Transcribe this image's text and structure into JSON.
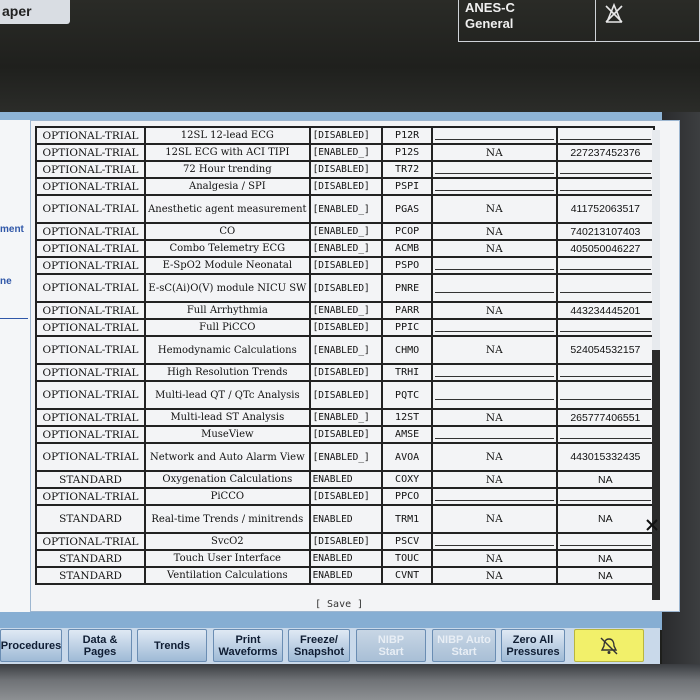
{
  "header": {
    "top_left_fragment": "aper",
    "profile_line1": "ANES-C",
    "profile_line2": "General"
  },
  "left_strip": {
    "fragment1": "ment",
    "fragment2": "ne"
  },
  "licenses": {
    "rows": [
      {
        "type": "OPTIONAL-TRIAL",
        "name": "12SL 12-lead ECG",
        "state": "[DISABLED]",
        "code": "P12R",
        "capability": "",
        "key": ""
      },
      {
        "type": "OPTIONAL-TRIAL",
        "name": "12SL ECG with ACI TIPI",
        "state": "[ENABLED_]",
        "code": "P12S",
        "capability": "NA",
        "key": "227237452376"
      },
      {
        "type": "OPTIONAL-TRIAL",
        "name": "72 Hour trending",
        "state": "[DISABLED]",
        "code": "TR72",
        "capability": "",
        "key": ""
      },
      {
        "type": "OPTIONAL-TRIAL",
        "name": "Analgesia / SPI",
        "state": "[DISABLED]",
        "code": "PSPI",
        "capability": "",
        "key": ""
      },
      {
        "type": "OPTIONAL-TRIAL",
        "name": "Anesthetic agent measurement",
        "state": "[ENABLED_]",
        "code": "PGAS",
        "capability": "NA",
        "key": "411752063517",
        "tall": true
      },
      {
        "type": "OPTIONAL-TRIAL",
        "name": "CO",
        "state": "[ENABLED_]",
        "code": "PCOP",
        "capability": "NA",
        "key": "740213107403"
      },
      {
        "type": "OPTIONAL-TRIAL",
        "name": "Combo Telemetry ECG",
        "state": "[ENABLED_]",
        "code": "ACMB",
        "capability": "NA",
        "key": "405050046227"
      },
      {
        "type": "OPTIONAL-TRIAL",
        "name": "E-SpO2 Module Neonatal",
        "state": "[DISABLED]",
        "code": "PSPO",
        "capability": "",
        "key": ""
      },
      {
        "type": "OPTIONAL-TRIAL",
        "name": "E-sC(Ai)O(V) module NICU SW",
        "state": "[DISABLED]",
        "code": "PNRE",
        "capability": "",
        "key": "",
        "tall": true
      },
      {
        "type": "OPTIONAL-TRIAL",
        "name": "Full Arrhythmia",
        "state": "[ENABLED_]",
        "code": "PARR",
        "capability": "NA",
        "key": "443234445201"
      },
      {
        "type": "OPTIONAL-TRIAL",
        "name": "Full PiCCO",
        "state": "[DISABLED]",
        "code": "PPIC",
        "capability": "",
        "key": ""
      },
      {
        "type": "OPTIONAL-TRIAL",
        "name": "Hemodynamic Calculations",
        "state": "[ENABLED_]",
        "code": "CHMO",
        "capability": "NA",
        "key": "524054532157",
        "tall": true
      },
      {
        "type": "OPTIONAL-TRIAL",
        "name": "High Resolution Trends",
        "state": "[DISABLED]",
        "code": "TRHI",
        "capability": "",
        "key": ""
      },
      {
        "type": "OPTIONAL-TRIAL",
        "name": "Multi-lead QT / QTc Analysis",
        "state": "[DISABLED]",
        "code": "PQTC",
        "capability": "",
        "key": "",
        "tall": true
      },
      {
        "type": "OPTIONAL-TRIAL",
        "name": "Multi-lead ST Analysis",
        "state": "[ENABLED_]",
        "code": "12ST",
        "capability": "NA",
        "key": "265777406551"
      },
      {
        "type": "OPTIONAL-TRIAL",
        "name": "MuseView",
        "state": "[DISABLED]",
        "code": "AMSE",
        "capability": "",
        "key": ""
      },
      {
        "type": "OPTIONAL-TRIAL",
        "name": "Network and Auto Alarm View",
        "state": "[ENABLED_]",
        "code": "AVOA",
        "capability": "NA",
        "key": "443015332435",
        "tall": true
      },
      {
        "type": "STANDARD",
        "name": "Oxygenation Calculations",
        "state": "ENABLED",
        "code": "COXY",
        "capability": "NA",
        "key": "NA"
      },
      {
        "type": "OPTIONAL-TRIAL",
        "name": "PiCCO",
        "state": "[DISABLED]",
        "code": "PPCO",
        "capability": "",
        "key": ""
      },
      {
        "type": "STANDARD",
        "name": "Real-time Trends / minitrends",
        "state": "ENABLED",
        "code": "TRM1",
        "capability": "NA",
        "key": "NA",
        "tall": true
      },
      {
        "type": "OPTIONAL-TRIAL",
        "name": "SvcO2",
        "state": "[DISABLED]",
        "code": "PSCV",
        "capability": "",
        "key": ""
      },
      {
        "type": "STANDARD",
        "name": "Touch User Interface",
        "state": "ENABLED",
        "code": "TOUC",
        "capability": "NA",
        "key": "NA"
      },
      {
        "type": "STANDARD",
        "name": "Ventilation Calculations",
        "state": "ENABLED",
        "code": "CVNT",
        "capability": "NA",
        "key": "NA"
      }
    ]
  },
  "save_label": "[ Save ]",
  "keys": [
    {
      "label": "Procedures",
      "disabled": false
    },
    {
      "label": "Data &\nPages",
      "disabled": false
    },
    {
      "label": "Trends",
      "disabled": false
    },
    {
      "label": "Print\nWaveforms",
      "disabled": false
    },
    {
      "label": "Freeze/\nSnapshot",
      "disabled": false
    },
    {
      "label": "NIBP\nStart",
      "disabled": true
    },
    {
      "label": "NIBP Auto\nStart",
      "disabled": true
    },
    {
      "label": "Zero All\nPressures",
      "disabled": false
    }
  ],
  "icons": {
    "alarm_silence": "alarm-silence-icon",
    "alarm_off": "alarm-off-icon",
    "close": "close-icon"
  },
  "colors": {
    "screen_blue": "#8eb4d6",
    "key_yellow": "#f2f06a",
    "link_blue": "#2f57a8"
  }
}
